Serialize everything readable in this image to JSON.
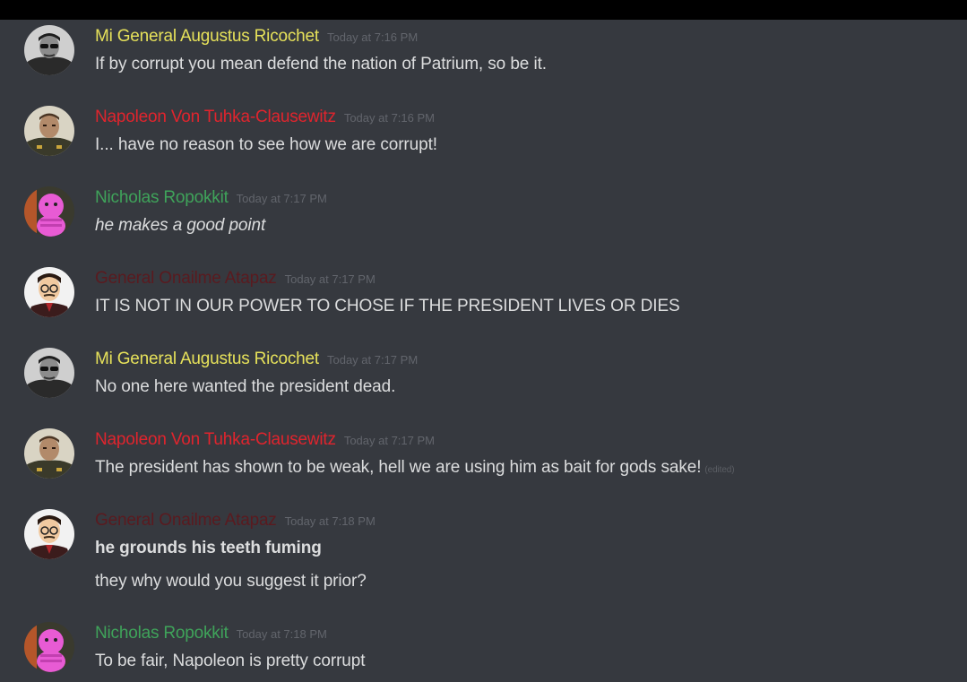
{
  "messages": [
    {
      "author": "Mi General Augustus Ricochet",
      "author_color": "#e6e15a",
      "avatar": "bw-man-sunglasses",
      "timestamp": "Today at 7:16 PM",
      "lines": [
        "If by corrupt you mean defend the nation of Patrium, so be it."
      ]
    },
    {
      "author": "Napoleon Von Tuhka-Clausewitz",
      "author_color": "#e0242d",
      "avatar": "military-officer",
      "timestamp": "Today at 7:16 PM",
      "lines": [
        "I... have no reason to see how we are corrupt!"
      ]
    },
    {
      "author": "Nicholas Ropokkit",
      "author_color": "#3fa35a",
      "avatar": "pink-creature",
      "timestamp": "Today at 7:17 PM",
      "lines": [
        "he makes a good point"
      ]
    },
    {
      "author": "General Onailme Atapaz",
      "author_color": "#5a1a1f",
      "avatar": "cartoon-man-glasses",
      "timestamp": "Today at 7:17 PM",
      "lines": [
        "IT IS NOT IN OUR POWER TO CHOSE IF THE PRESIDENT LIVES OR DIES"
      ]
    },
    {
      "author": "Mi General Augustus Ricochet",
      "author_color": "#e6e15a",
      "avatar": "bw-man-sunglasses",
      "timestamp": "Today at 7:17 PM",
      "lines": [
        "No one here wanted the president dead."
      ]
    },
    {
      "author": "Napoleon Von Tuhka-Clausewitz",
      "author_color": "#e0242d",
      "avatar": "military-officer",
      "timestamp": "Today at 7:17 PM",
      "lines": [
        "The president has shown to be weak, hell we are using him as bait for gods sake!"
      ],
      "edited": "(edited)"
    },
    {
      "author": "General Onailme Atapaz",
      "author_color": "#5a1a1f",
      "avatar": "cartoon-man-glasses",
      "timestamp": "Today at 7:18 PM",
      "lines": [
        "he grounds his teeth fuming",
        "they why would you suggest it prior?"
      ]
    },
    {
      "author": "Nicholas Ropokkit",
      "author_color": "#3fa35a",
      "avatar": "pink-creature",
      "timestamp": "Today at 7:18 PM",
      "lines": [
        "To be fair, Napoleon is pretty corrupt"
      ]
    }
  ]
}
